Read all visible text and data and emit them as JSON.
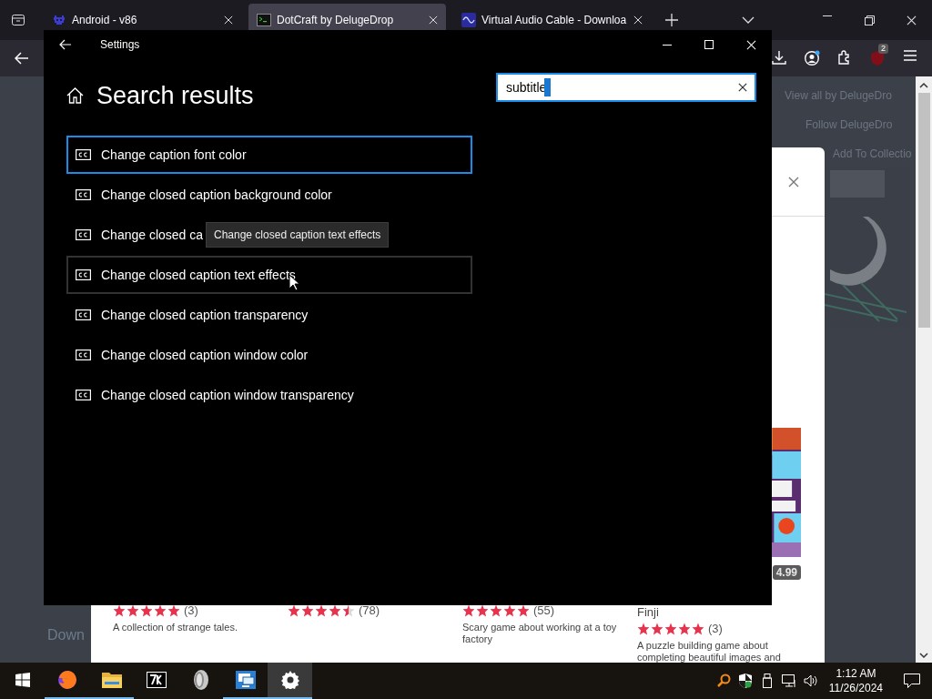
{
  "browser": {
    "tabs": [
      {
        "title": "Android - v86",
        "selected": false,
        "kind": "invader"
      },
      {
        "title": "DotCraft by DelugeDrop",
        "selected": true,
        "kind": "terminal"
      },
      {
        "title": "Virtual Audio Cable - Downloa",
        "selected": false,
        "kind": "wave"
      }
    ],
    "toolbar": {
      "extension_badge": "2"
    },
    "page": {
      "sidebar_links": [
        "View all by DelugeDro",
        "Follow DelugeDro",
        "Add To Collectio"
      ],
      "left_text": "Down",
      "games": [
        {
          "stars": 5,
          "count": "(3)",
          "description": "A collection of strange tales."
        },
        {
          "stars": 4.5,
          "count": "(78)"
        },
        {
          "stars": 5,
          "count": "(55)",
          "description": "Scary game about working at a toy factory"
        },
        {
          "kind": "picture",
          "price": "4.99",
          "author": "Finji",
          "stars": 5,
          "count": "(3)",
          "description": "A puzzle building game about completing beautiful images and"
        }
      ]
    }
  },
  "settings": {
    "title": "Settings",
    "heading": "Search results",
    "search": {
      "value": "subtitle"
    },
    "results": [
      {
        "label": "Change caption font color",
        "selected": true,
        "hovered": false
      },
      {
        "label": "Change closed caption background color",
        "selected": false,
        "hovered": false
      },
      {
        "label": "Change closed ca",
        "selected": false,
        "hovered": false
      },
      {
        "label": "Change closed caption text effects",
        "selected": false,
        "hovered": true
      },
      {
        "label": "Change closed caption transparency",
        "selected": false,
        "hovered": false
      },
      {
        "label": "Change closed caption window color",
        "selected": false,
        "hovered": false
      },
      {
        "label": "Change closed caption window transparency",
        "selected": false,
        "hovered": false
      }
    ],
    "tooltip": "Change closed caption text effects"
  },
  "taskbar": {
    "apps": [
      {
        "kind": "fox",
        "running": true,
        "selected": false
      },
      {
        "kind": "folder",
        "running": true,
        "selected": false
      },
      {
        "kind": "archive",
        "running": false,
        "selected": false
      },
      {
        "kind": "disc",
        "running": false,
        "selected": false
      },
      {
        "kind": "remote",
        "running": true,
        "selected": false
      },
      {
        "kind": "gear",
        "running": true,
        "selected": true
      }
    ],
    "time": "1:12 AM",
    "date": "11/26/2024"
  }
}
